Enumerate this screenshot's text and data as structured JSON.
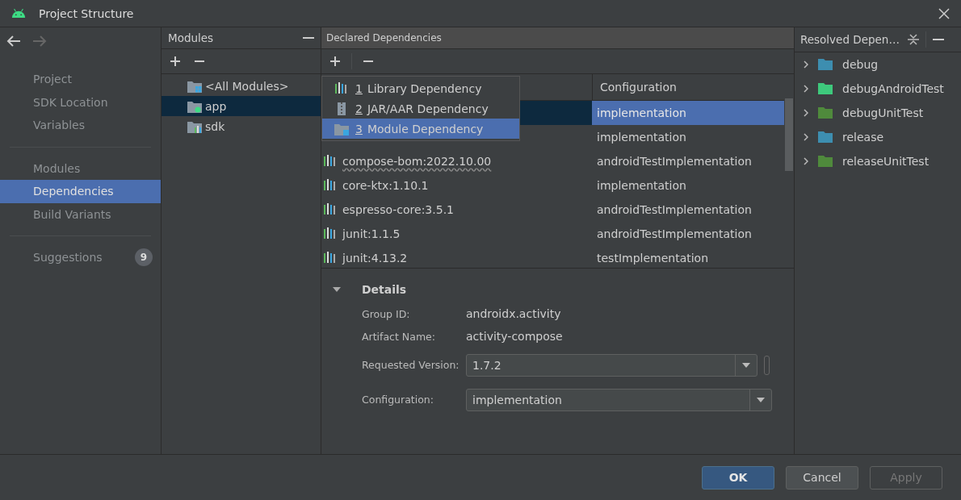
{
  "window": {
    "title": "Project Structure"
  },
  "sidebar": {
    "groups": [
      [
        {
          "label": "Project",
          "selected": false
        },
        {
          "label": "SDK Location",
          "selected": false
        },
        {
          "label": "Variables",
          "selected": false
        }
      ],
      [
        {
          "label": "Modules",
          "selected": false
        },
        {
          "label": "Dependencies",
          "selected": true
        },
        {
          "label": "Build Variants",
          "selected": false
        }
      ],
      [
        {
          "label": "Suggestions",
          "selected": false,
          "badge": "9"
        }
      ]
    ]
  },
  "modules": {
    "title": "Modules",
    "items": [
      {
        "label": "<All Modules>",
        "kind": "all",
        "selected": false
      },
      {
        "label": "app",
        "kind": "app",
        "selected": true
      },
      {
        "label": "sdk",
        "kind": "library",
        "selected": false
      }
    ]
  },
  "declared": {
    "title": "Declared Dependencies",
    "menu": [
      {
        "number": "1",
        "label": "Library Dependency",
        "kind": "library",
        "selected": false
      },
      {
        "number": "2",
        "label": "JAR/AAR Dependency",
        "kind": "jar",
        "selected": false
      },
      {
        "number": "3",
        "label": "Module Dependency",
        "kind": "module",
        "selected": true
      }
    ],
    "table": {
      "columns": [
        "Configuration"
      ],
      "rows": [
        {
          "configuration": "implementation",
          "selected": true
        },
        {
          "configuration": "implementation",
          "selected": false
        },
        {
          "name": "compose-bom:2022.10.00",
          "configuration": "androidTestImplementation",
          "selected": false,
          "warning": true
        },
        {
          "name": "core-ktx:1.10.1",
          "configuration": "implementation",
          "selected": false,
          "warning": false
        },
        {
          "name": "espresso-core:3.5.1",
          "configuration": "androidTestImplementation",
          "selected": false,
          "warning": false
        },
        {
          "name": "junit:1.1.5",
          "configuration": "androidTestImplementation",
          "selected": false,
          "warning": false
        },
        {
          "name": "junit:4.13.2",
          "configuration": "testImplementation",
          "selected": false,
          "warning": false
        }
      ]
    },
    "details": {
      "title": "Details",
      "expanded": true,
      "fields": [
        {
          "label": "Group ID:",
          "value": "androidx.activity",
          "kind": "text"
        },
        {
          "label": "Artifact Name:",
          "value": "activity-compose",
          "kind": "text"
        },
        {
          "label": "Requested Version:",
          "value": "1.7.2",
          "kind": "combo"
        },
        {
          "label": "Configuration:",
          "value": "implementation",
          "kind": "combo"
        }
      ]
    }
  },
  "resolved": {
    "title": "Resolved Depen…",
    "items": [
      {
        "label": "debug",
        "color": "#3d8eb0"
      },
      {
        "label": "debugAndroidTest",
        "color": "#3ec97c"
      },
      {
        "label": "debugUnitTest",
        "color": "#4f8a3c"
      },
      {
        "label": "release",
        "color": "#3d8eb0"
      },
      {
        "label": "releaseUnitTest",
        "color": "#4f8a3c"
      }
    ]
  },
  "buttons": [
    {
      "label": "OK",
      "kind": "primary",
      "disabled": false
    },
    {
      "label": "Cancel",
      "kind": "normal",
      "disabled": false
    },
    {
      "label": "Apply",
      "kind": "normal",
      "disabled": true
    }
  ]
}
